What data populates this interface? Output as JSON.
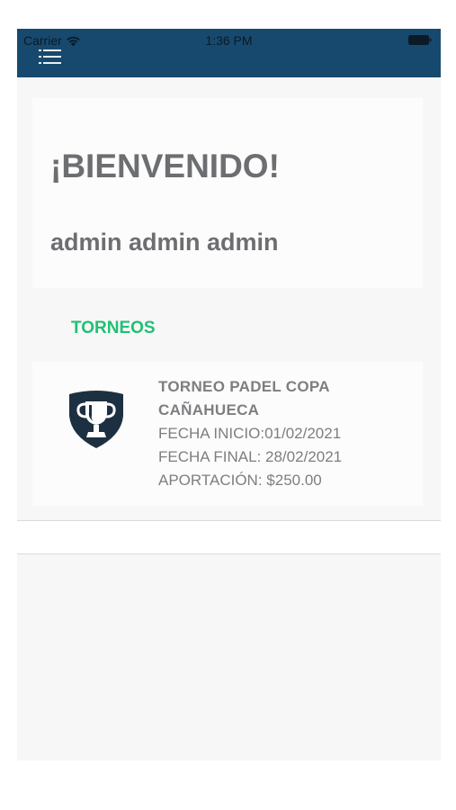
{
  "status_bar": {
    "carrier": "Carrier",
    "time": "1:36 PM",
    "background_color": "#17496e"
  },
  "header": {
    "menu_icon": "hamburger-list-icon"
  },
  "welcome": {
    "title": "¡BIENVENIDO!",
    "user_name": "admin admin admin"
  },
  "tournaments": {
    "section_label": "TORNEOS",
    "accent_color": "#22bf74",
    "items": [
      {
        "icon": "trophy-shield-icon",
        "name": "TORNEO PADEL COPA CAÑAHUECA",
        "start_date": "FECHA INICIO:01/02/2021",
        "end_date": "FECHA FINAL: 28/02/2021",
        "contribution": "APORTACIÓN: $250.00"
      }
    ]
  }
}
